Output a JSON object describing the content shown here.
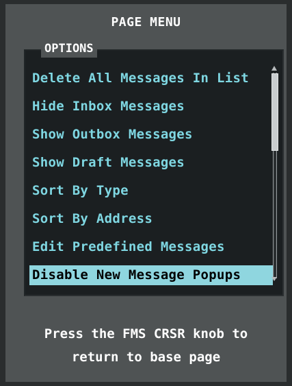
{
  "window": {
    "title": "PAGE MENU"
  },
  "options": {
    "label": "OPTIONS"
  },
  "menu": {
    "items": [
      {
        "label": "Delete All Messages In List"
      },
      {
        "label": "Hide Inbox Messages"
      },
      {
        "label": "Show Outbox Messages"
      },
      {
        "label": "Show Draft Messages"
      },
      {
        "label": "Sort By Type"
      },
      {
        "label": "Sort By Address"
      },
      {
        "label": "Edit Predefined Messages"
      },
      {
        "label": "Disable New Message Popups"
      }
    ],
    "selected_index": 7
  },
  "scrollbar": {
    "visible_fraction": 0.37
  },
  "hint": {
    "line1": "Press the FMS CRSR knob to",
    "line2": "return to base page"
  },
  "colors": {
    "menu_text": "#7fd7e2",
    "selected_bg": "#8fd6df",
    "panel_bg": "#4f5354",
    "list_bg": "#1b1f21"
  }
}
